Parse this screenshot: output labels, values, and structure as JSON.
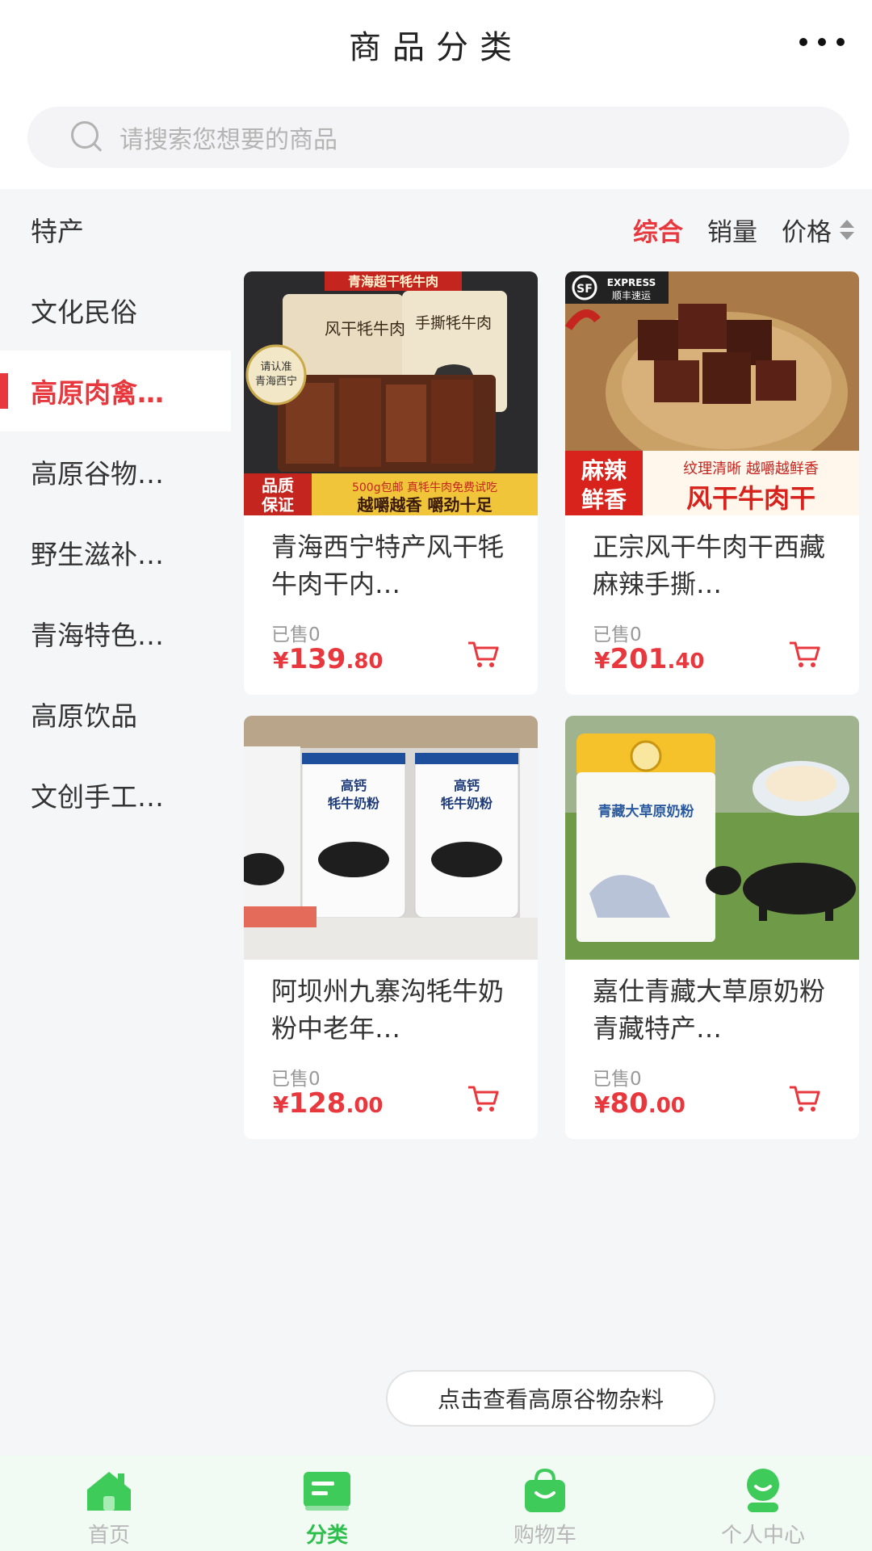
{
  "header": {
    "title": "商品分类",
    "more_icon": "more-dots-icon"
  },
  "search": {
    "placeholder": "请搜索您想要的商品",
    "icon": "search-icon"
  },
  "sidebar": {
    "items": [
      {
        "label": "特产",
        "active": false
      },
      {
        "label": "文化民俗",
        "active": false
      },
      {
        "label": "高原肉禽…",
        "active": true
      },
      {
        "label": "高原谷物…",
        "active": false
      },
      {
        "label": "野生滋补…",
        "active": false
      },
      {
        "label": "青海特色…",
        "active": false
      },
      {
        "label": "高原饮品",
        "active": false
      },
      {
        "label": "文创手工…",
        "active": false
      }
    ]
  },
  "sort": {
    "comprehensive": "综合",
    "sales": "销量",
    "price": "价格",
    "active": "综合"
  },
  "products": [
    {
      "name": "青海西宁特产风干牦牛肉干内…",
      "sold": "已售0",
      "currency": "¥",
      "price_int": "139",
      "price_dec": ".80",
      "image_text": {
        "banner": "青海超干牦牛肉",
        "pack1": "风干牦牛肉",
        "pack2": "手撕牦牛肉",
        "badge": "请认准 青海西宁",
        "quality": "品质保证",
        "promo1": "500g包邮 真牦牛肉免费试吃",
        "promo2": "越嚼越香 嚼劲十足"
      }
    },
    {
      "name": "正宗风干牛肉干西藏麻辣手撕…",
      "sold": "已售0",
      "currency": "¥",
      "price_int": "201",
      "price_dec": ".40",
      "image_text": {
        "express": "EXPRESS 顺丰速运",
        "spicy": "麻辣鲜香",
        "tagline": "纹理清晰 越嚼越鲜香",
        "title": "风干牛肉干"
      }
    },
    {
      "name": "阿坝州九寨沟牦牛奶粉中老年…",
      "sold": "已售0",
      "currency": "¥",
      "price_int": "128",
      "price_dec": ".00",
      "image_text": {
        "can": "高钙牦牛奶粉"
      }
    },
    {
      "name": "嘉仕青藏大草原奶粉青藏特产…",
      "sold": "已售0",
      "currency": "¥",
      "price_int": "80",
      "price_dec": ".00",
      "image_text": {
        "can": "青藏大草原奶粉"
      }
    }
  ],
  "more_button": "点击查看高原谷物杂料",
  "tabbar": [
    {
      "label": "首页",
      "icon": "home-icon",
      "active": false
    },
    {
      "label": "分类",
      "icon": "category-icon",
      "active": true
    },
    {
      "label": "购物车",
      "icon": "shopping-bag-icon",
      "active": false
    },
    {
      "label": "个人中心",
      "icon": "profile-icon",
      "active": false
    }
  ],
  "colors": {
    "accent": "#e8383d",
    "tab_active": "#2dbf4b",
    "tab_inactive": "#b7b7b7"
  }
}
